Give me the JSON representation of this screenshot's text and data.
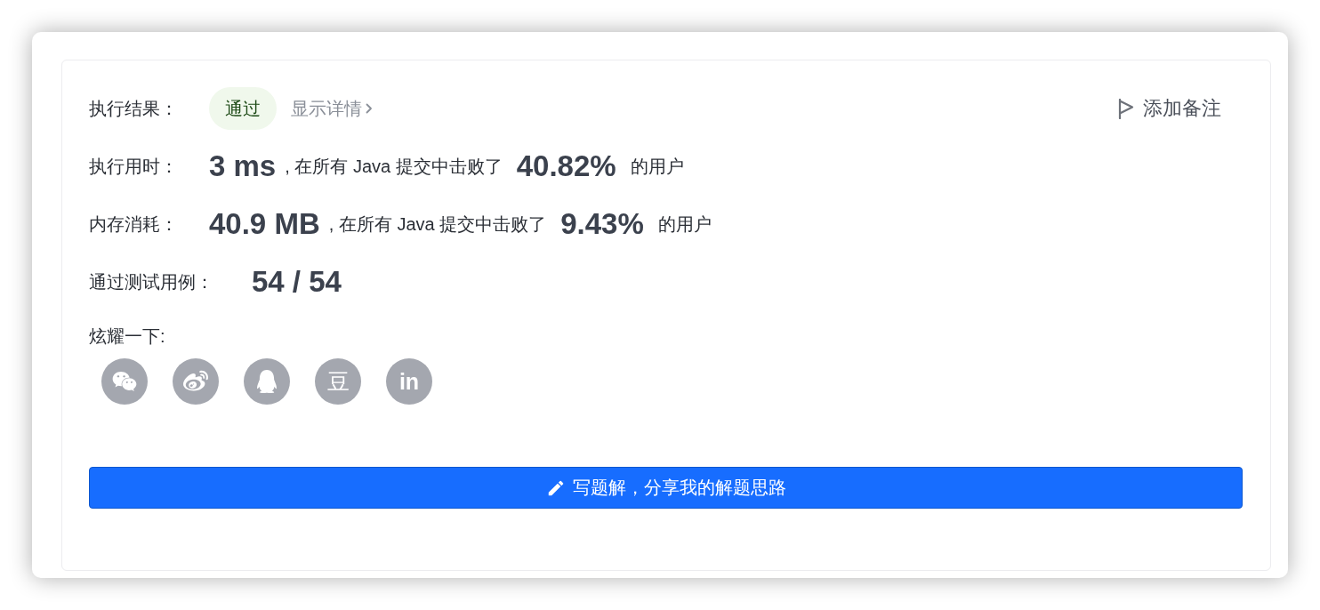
{
  "result": {
    "label": "执行结果：",
    "status": {
      "text": "通过",
      "kind": "accepted"
    },
    "details_link": "显示详情",
    "add_note": "添加备注"
  },
  "stats": [
    {
      "label": "执行用时：",
      "value": "3 ms",
      "beats_text": ", 在所有 Java 提交中击败了",
      "percent": "40.82%",
      "suffix": "的用户"
    },
    {
      "label": "内存消耗：",
      "value": "40.9 MB",
      "beats_text": ", 在所有 Java 提交中击败了",
      "percent": "9.43%",
      "suffix": "的用户"
    }
  ],
  "test_cases": {
    "label": "通过测试用例：",
    "value": "54 / 54"
  },
  "share": {
    "label": "炫耀一下:",
    "buttons": [
      {
        "kind": "wechat"
      },
      {
        "kind": "weibo"
      },
      {
        "kind": "qq"
      },
      {
        "kind": "glyph",
        "text": "豆"
      },
      {
        "kind": "glyph",
        "text": "in"
      }
    ]
  },
  "write_button": {
    "label": "写题解，分享我的解题思路"
  }
}
